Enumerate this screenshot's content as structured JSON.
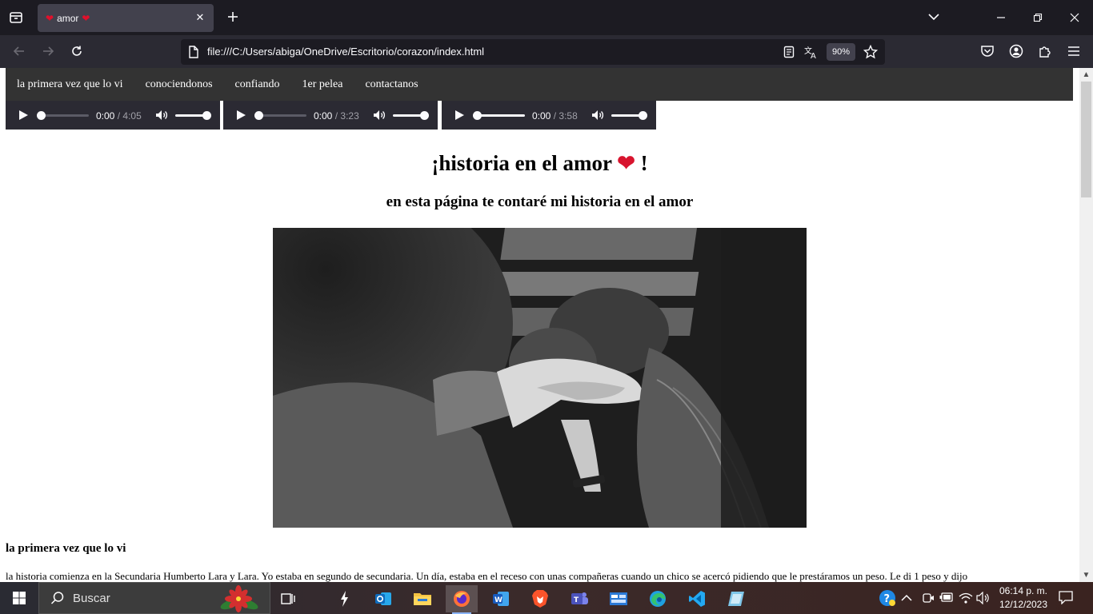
{
  "browser": {
    "tab": {
      "title": "amor",
      "heart_left": "❤",
      "heart_right": "❤"
    },
    "url": "file:///C:/Users/abiga/OneDrive/Escritorio/corazon/index.html",
    "zoom": "90%"
  },
  "site": {
    "nav": [
      {
        "label": "la primera vez que lo vi"
      },
      {
        "label": "conociendonos"
      },
      {
        "label": "confiando"
      },
      {
        "label": "1er pelea"
      },
      {
        "label": "contactanos"
      }
    ],
    "players": [
      {
        "current": "0:00",
        "sep": "/",
        "duration": "4:05",
        "volume": 1.0,
        "progress": 0
      },
      {
        "current": "0:00",
        "sep": "/",
        "duration": "3:23",
        "volume": 1.0,
        "progress": 0
      },
      {
        "current": "0:00",
        "sep": "/",
        "duration": "3:58",
        "volume": 1.0,
        "progress": 0
      }
    ],
    "heading": "¡historia en el amor",
    "heading_heart": "❤",
    "heading_end": "!",
    "subheading": "en esta página te contaré mi historia en el amor",
    "section_title": "la primera vez que lo vi",
    "section_text": "la historia comienza en la Secundaria Humberto Lara y Lara. Yo estaba en segundo de secundaria. Un día, estaba en el receso con unas compañeras cuando un chico se acercó pidiendo que le prestáramos un peso. Le di 1 peso y dijo"
  },
  "taskbar": {
    "search_label": "Buscar",
    "time": "06:14 p. m.",
    "date": "12/12/2023"
  },
  "colors": {
    "site_nav_bg": "#333333",
    "heart": "#d8142e",
    "browser_bg": "#1c1b22"
  }
}
